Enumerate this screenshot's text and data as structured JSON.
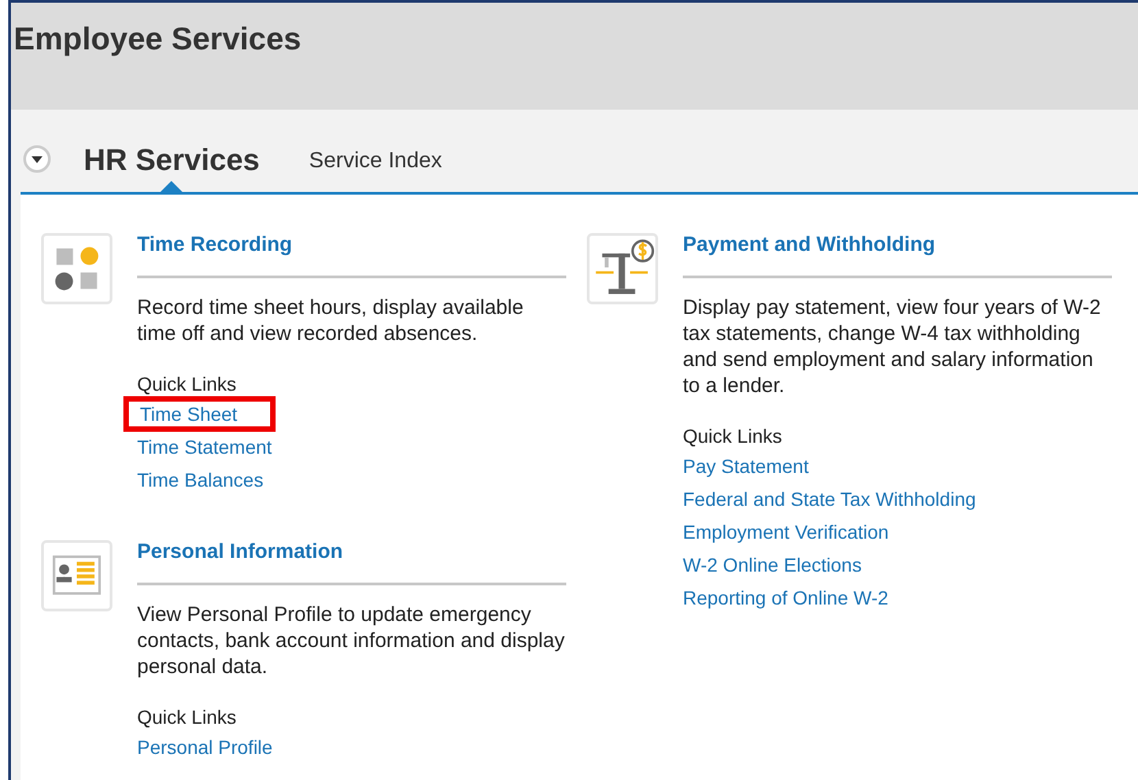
{
  "page_title": "Employee Services",
  "tabs": [
    {
      "label": "HR Services",
      "selected": true
    },
    {
      "label": "Service Index",
      "selected": false
    }
  ],
  "columns": [
    {
      "sections": [
        {
          "kind": "shapes",
          "title": "Time Recording",
          "description": "Record time sheet hours, display available time off and view recorded absences.",
          "quick_links_label": "Quick Links",
          "links": [
            {
              "label": "Time Sheet",
              "highlighted": true
            },
            {
              "label": "Time Statement",
              "highlighted": false
            },
            {
              "label": "Time Balances",
              "highlighted": false
            }
          ]
        },
        {
          "kind": "profile",
          "title": "Personal Information",
          "description": "View Personal Profile to update emergency contacts, bank account information and display personal data.",
          "quick_links_label": "Quick Links",
          "links": [
            {
              "label": "Personal Profile",
              "highlighted": false
            }
          ]
        }
      ]
    },
    {
      "sections": [
        {
          "kind": "scale",
          "title": "Payment and Withholding",
          "description": "Display pay statement, view four years of W-2 tax statements, change W-4 tax withholding and send employment and salary information to a lender.",
          "quick_links_label": "Quick Links",
          "links": [
            {
              "label": "Pay Statement",
              "highlighted": false
            },
            {
              "label": "Federal and State Tax Withholding",
              "highlighted": false
            },
            {
              "label": "Employment Verification",
              "highlighted": false
            },
            {
              "label": "W-2 Online Elections",
              "highlighted": false
            },
            {
              "label": "Reporting of Online W-2",
              "highlighted": false
            }
          ]
        }
      ]
    }
  ]
}
